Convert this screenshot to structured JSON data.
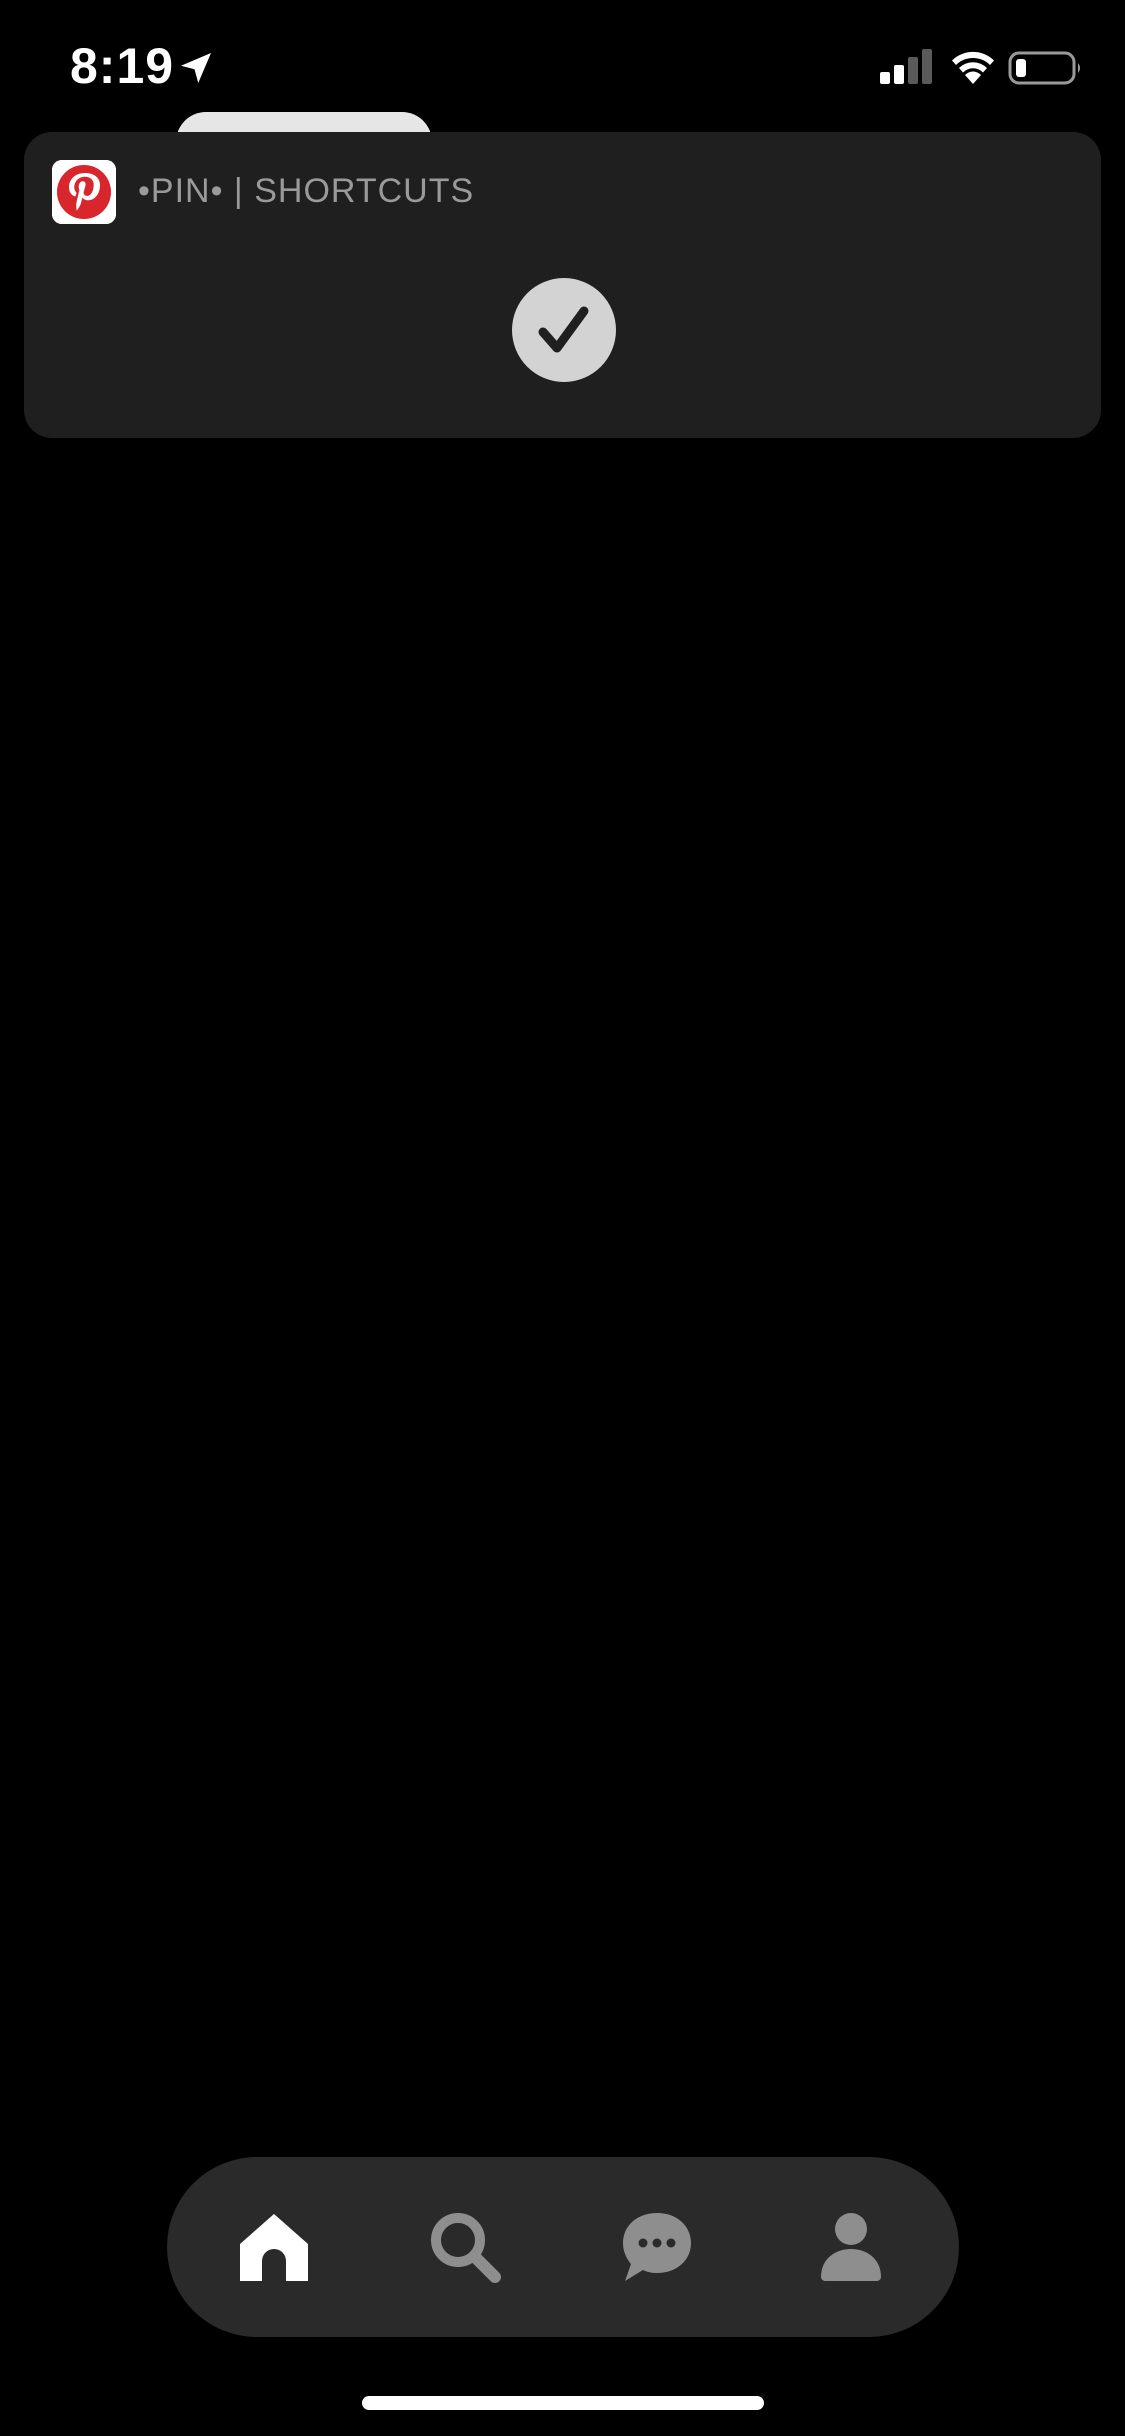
{
  "status_bar": {
    "time": "8:19",
    "icons": [
      "location-arrow-icon",
      "cellular-signal-icon",
      "wifi-icon",
      "battery-icon"
    ]
  },
  "notification": {
    "app_icon": "pinterest-logo-icon",
    "title": "•PIN• | SHORTCUTS",
    "status_icon": "checkmark-icon"
  },
  "tab_bar": {
    "tabs": [
      {
        "icon": "home-icon",
        "active": true
      },
      {
        "icon": "search-icon",
        "active": false
      },
      {
        "icon": "messages-icon",
        "active": false
      },
      {
        "icon": "profile-icon",
        "active": false
      }
    ]
  },
  "colors": {
    "background": "#000000",
    "banner": "#1f1f1f",
    "tab_bar": "#2a2a2a",
    "active_tab": "#ffffff",
    "inactive_tab": "#8e8e8e",
    "pinterest_red": "#d8262c"
  }
}
